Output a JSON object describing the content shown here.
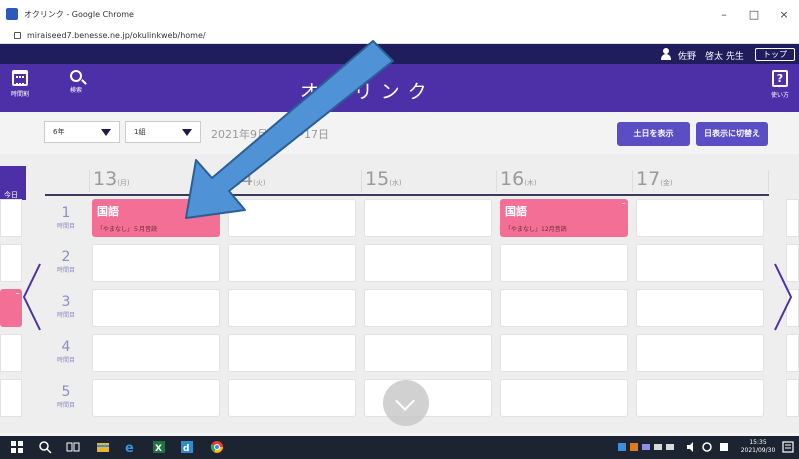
{
  "window": {
    "title": "オクリンク - Google Chrome",
    "minimize": "–",
    "maximize": "□",
    "close": "×"
  },
  "browser": {
    "url": "miraiseed7.benesse.ne.jp/okulinkweb/home/"
  },
  "user": {
    "name": "佐野　啓太 先生",
    "top_button": "トップ"
  },
  "header": {
    "title": "オクリンク",
    "timetable_label": "時間割",
    "search_label": "検索",
    "help_label": "使い方"
  },
  "filters": {
    "grade": "6年",
    "class": "1組",
    "date_range": "2021年9月13日〜17日",
    "show_weekend_button": "土日を表示",
    "switch_day_button": "日表示に切替え"
  },
  "timetable": {
    "today_label": "今日",
    "days": [
      {
        "date": "13",
        "weekday": "(月)"
      },
      {
        "date": "14",
        "weekday": "(火)"
      },
      {
        "date": "15",
        "weekday": "(水)"
      },
      {
        "date": "16",
        "weekday": "(木)"
      },
      {
        "date": "17",
        "weekday": "(金)"
      }
    ],
    "periods": [
      {
        "num": "1",
        "label": "時間目"
      },
      {
        "num": "2",
        "label": "時間目"
      },
      {
        "num": "3",
        "label": "時間目"
      },
      {
        "num": "4",
        "label": "時間目"
      },
      {
        "num": "5",
        "label": "時間目"
      }
    ],
    "lessons": [
      {
        "subject": "国語",
        "desc": "「やまなし」５月音読",
        "more": "···"
      },
      {
        "subject": "国語",
        "desc": "「やまなし」12月音読",
        "more": "···"
      }
    ],
    "edge_more": "···"
  },
  "taskbar": {
    "time": "15:35",
    "date": "2021/09/30"
  },
  "colors": {
    "header_purple": "#4d2fa8",
    "user_bar": "#1f1d5c",
    "lesson_pink": "#f36f96",
    "button_purple": "#5b4dc3",
    "arrow_blue": "#4f93d6"
  }
}
